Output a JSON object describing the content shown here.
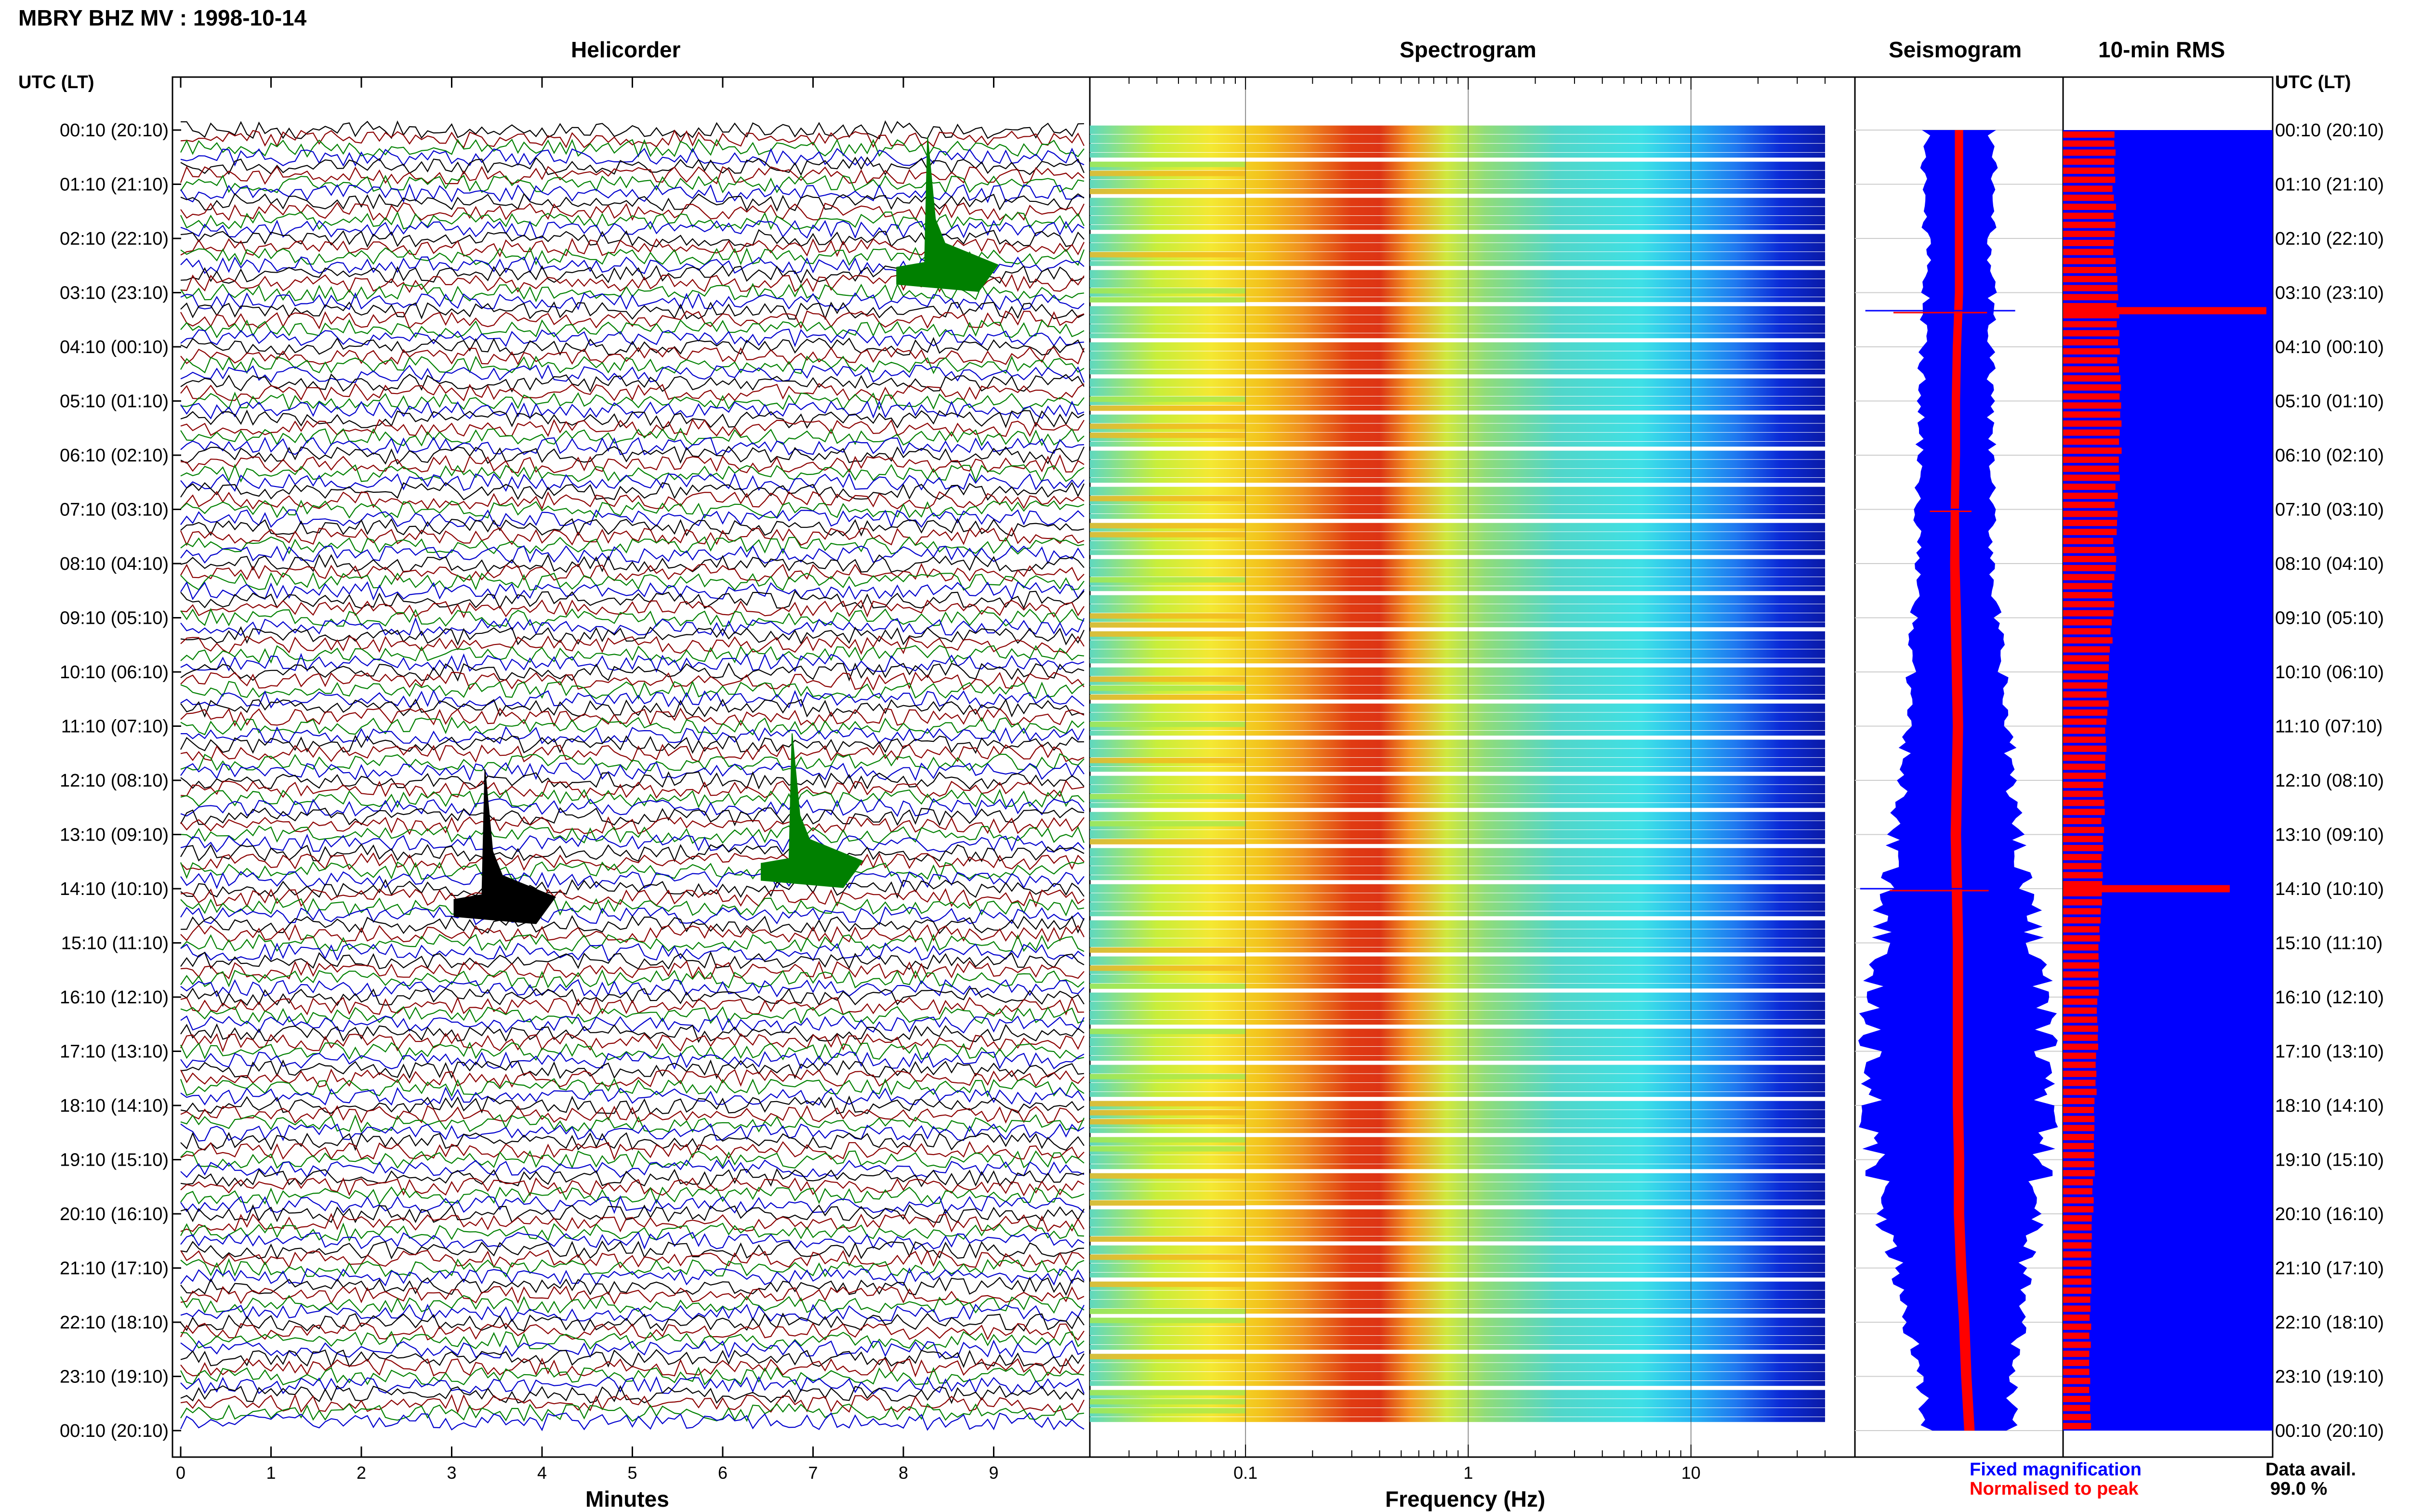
{
  "header": {
    "station_title": "MBRY BHZ MV : 1998-10-14"
  },
  "panels": {
    "helicorder_title": "Helicorder",
    "spectrogram_title": "Spectrogram",
    "seismogram_title": "Seismogram",
    "rms_title": "10-min RMS"
  },
  "axes": {
    "time_axis_title_left": "UTC (LT)",
    "time_axis_title_right": "UTC (LT)",
    "helicorder_xlabel": "Minutes",
    "spectrogram_xlabel": "Frequency (Hz)"
  },
  "legend": {
    "fixed_label": "Fixed magnification",
    "normalised_label": "Normalised to peak",
    "fixed_color": "#0000ff",
    "normalised_color": "#ff0000",
    "avail_label": "Data avail.",
    "avail_value": "99.0 %"
  },
  "chart_data": [
    {
      "type": "line",
      "title": "Helicorder",
      "xlabel": "Minutes",
      "ylabel": "UTC (LT)",
      "x_ticks": [
        "0",
        "1",
        "2",
        "3",
        "4",
        "5",
        "6",
        "7",
        "8",
        "9"
      ],
      "xlim": [
        0,
        10
      ],
      "row_count": 144,
      "minutes_per_row": 10,
      "trace_colors": [
        "#000000",
        "#8b0000",
        "#008000",
        "#0000cd"
      ],
      "y_ticks": [
        "00:10 (20:10)",
        "01:10 (21:10)",
        "02:10 (22:10)",
        "03:10 (23:10)",
        "04:10 (00:10)",
        "05:10 (01:10)",
        "06:10 (02:10)",
        "07:10 (03:10)",
        "08:10 (04:10)",
        "09:10 (05:10)",
        "10:10 (06:10)",
        "11:10 (07:10)",
        "12:10 (08:10)",
        "13:10 (09:10)",
        "14:10 (10:10)",
        "15:10 (11:10)",
        "16:10 (12:10)",
        "17:10 (13:10)",
        "18:10 (14:10)",
        "19:10 (15:10)",
        "20:10 (16:10)",
        "21:10 (17:10)",
        "22:10 (18:10)",
        "23:10 (19:10)",
        "00:10 (20:10)"
      ],
      "events": [
        {
          "time": "02:10",
          "minute": 8.3,
          "color": "#008000"
        },
        {
          "time": "13:10",
          "minute": 6.8,
          "color": "#008000"
        },
        {
          "time": "13:50",
          "minute": 3.4,
          "color": "#000000"
        }
      ]
    },
    {
      "type": "heatmap",
      "title": "Spectrogram",
      "xlabel": "Frequency (Hz)",
      "x_scale": "log",
      "xlim": [
        0.02,
        40
      ],
      "x_ticks": [
        "0.1",
        "1",
        "10"
      ],
      "colormap": "jet",
      "dominant_frequency_hz": 0.4,
      "energy_band_hz": [
        0.15,
        1.0
      ],
      "row_count": 144
    },
    {
      "type": "line",
      "title": "Seismogram",
      "series": [
        {
          "name": "Fixed magnification",
          "color": "#0000ff"
        },
        {
          "name": "Normalised to peak",
          "color": "#ff0000"
        }
      ],
      "fixed_amplitude_by_hour": [
        0.32,
        0.33,
        0.31,
        0.32,
        0.33,
        0.33,
        0.34,
        0.35,
        0.37,
        0.39,
        0.43,
        0.47,
        0.53,
        0.6,
        0.68,
        0.76,
        0.82,
        0.85,
        0.85,
        0.81,
        0.73,
        0.64,
        0.55,
        0.45,
        0.4
      ],
      "normalised_amplitude_by_hour": [
        0.04,
        0.04,
        0.04,
        0.04,
        0.04,
        0.04,
        0.04,
        0.04,
        0.045,
        0.05,
        0.05,
        0.05,
        0.05,
        0.05,
        0.05,
        0.05,
        0.05,
        0.05,
        0.05,
        0.05,
        0.05,
        0.05,
        0.05,
        0.05,
        0.05
      ],
      "center_drift_by_hour": [
        0.0,
        0.0,
        0.0,
        0.0,
        -0.02,
        -0.03,
        -0.03,
        -0.04,
        -0.04,
        -0.03,
        -0.02,
        -0.01,
        -0.02,
        -0.03,
        -0.02,
        -0.01,
        -0.01,
        -0.01,
        -0.01,
        0.0,
        0.0,
        0.02,
        0.05,
        0.07,
        0.1
      ],
      "spikes": [
        {
          "time": "03:30",
          "extent": 0.9
        },
        {
          "time": "07:10",
          "extent": 0.4
        },
        {
          "time": "14:10",
          "extent": 0.95
        }
      ]
    },
    {
      "type": "bar",
      "title": "10-min RMS",
      "series": [
        {
          "name": "10-min RMS",
          "color": "#ff0000"
        }
      ],
      "background_color": "#0000ff",
      "rms_by_hour": [
        0.56,
        0.55,
        0.55,
        0.57,
        0.6,
        0.62,
        0.6,
        0.56,
        0.55,
        0.52,
        0.49,
        0.46,
        0.44,
        0.42,
        0.41,
        0.39,
        0.37,
        0.36,
        0.34,
        0.33,
        0.31,
        0.3,
        0.29,
        0.29,
        0.29
      ],
      "spikes": [
        {
          "time": "03:30",
          "value": 1.0
        },
        {
          "time": "14:10",
          "value": 0.82
        }
      ]
    }
  ]
}
